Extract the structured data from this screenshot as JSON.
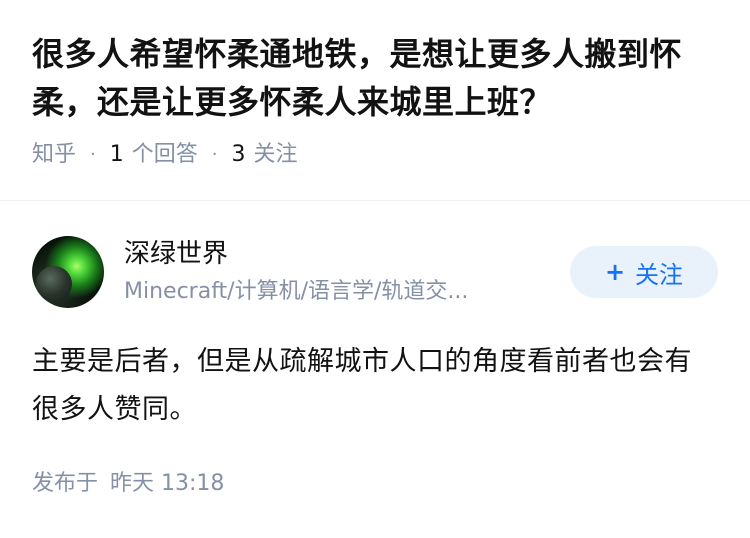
{
  "question": {
    "title": "很多人希望怀柔通地铁，是想让更多人搬到怀柔，还是让更多怀柔人来城里上班？",
    "source": "知乎",
    "answer_count": "1",
    "answer_label": "个回答",
    "follow_count": "3",
    "follow_label": "关注"
  },
  "author": {
    "name": "深绿世界",
    "bio": "Minecraft/计算机/语言学/轨道交...",
    "follow_button": "关注",
    "follow_button_icon": "plus-icon"
  },
  "answer": {
    "content": "主要是后者，但是从疏解城市人口的角度看前者也会有很多人赞同。",
    "published_label": "发布于",
    "published_time": "昨天 13:18"
  },
  "colors": {
    "text": "#121212",
    "meta": "#8590a6",
    "accent": "#1772f6",
    "button_bg": "#e9f2fb"
  }
}
